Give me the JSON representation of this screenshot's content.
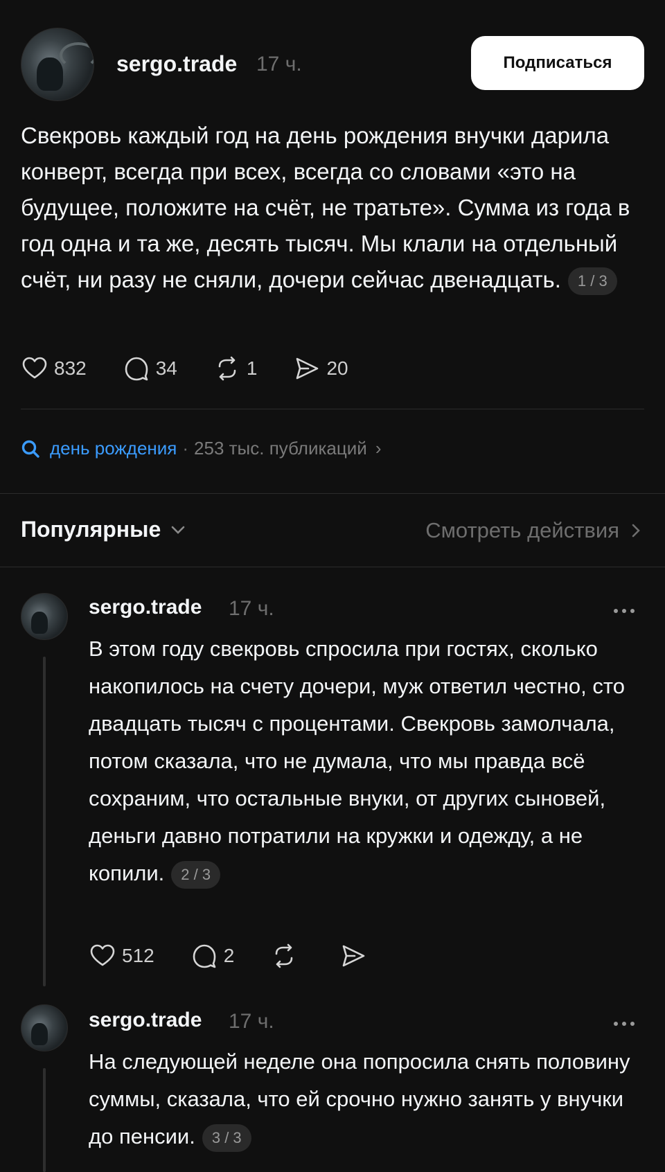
{
  "post": {
    "username": "sergo.trade",
    "time": "17 ч.",
    "follow_label": "Подписаться",
    "text": "Свекровь каждый год на день рождения внучки дарила конверт, всегда при всех, всегда со словами «это на будущее, положите на счёт, не тратьте». Сумма из года в год одна и та же, десять тысяч. Мы клали на отдельный счёт, ни разу не сняли, дочери сейчас двенадцать.",
    "part": "1 / 3",
    "likes": "832",
    "comments": "34",
    "reposts": "1",
    "shares": "20"
  },
  "topic": {
    "name": "день рождения",
    "separator": "·",
    "count": "253 тыс. публикаций"
  },
  "sort": {
    "label": "Популярные",
    "activity_label": "Смотреть действия"
  },
  "replies": [
    {
      "username": "sergo.trade",
      "time": "17 ч.",
      "text": "В этом году свекровь спросила при гостях, сколько накопилось на счету дочери, муж ответил честно, сто двадцать тысяч с процентами. Свекровь замолчала, потом сказала, что не думала, что мы правда всё сохраним, что остальные внуки, от других сыновей, деньги давно потратили на кружки и одежду, а не копили.",
      "part": "2 / 3",
      "likes": "512",
      "comments": "2"
    },
    {
      "username": "sergo.trade",
      "time": "17 ч.",
      "text": "На следующей неделе она попросила снять половину суммы, сказала, что ей срочно нужно занять у внучки до пенсии.",
      "part": "3 / 3"
    }
  ],
  "colors": {
    "background": "#101010",
    "text": "#f3f5f7",
    "muted": "#6e6e6e",
    "link": "#3b9cff",
    "button_bg": "#ffffff"
  },
  "icons": [
    "heart-icon",
    "comment-icon",
    "repost-icon",
    "share-icon",
    "search-icon",
    "chevron-right-icon",
    "chevron-down-icon",
    "more-icon"
  ]
}
